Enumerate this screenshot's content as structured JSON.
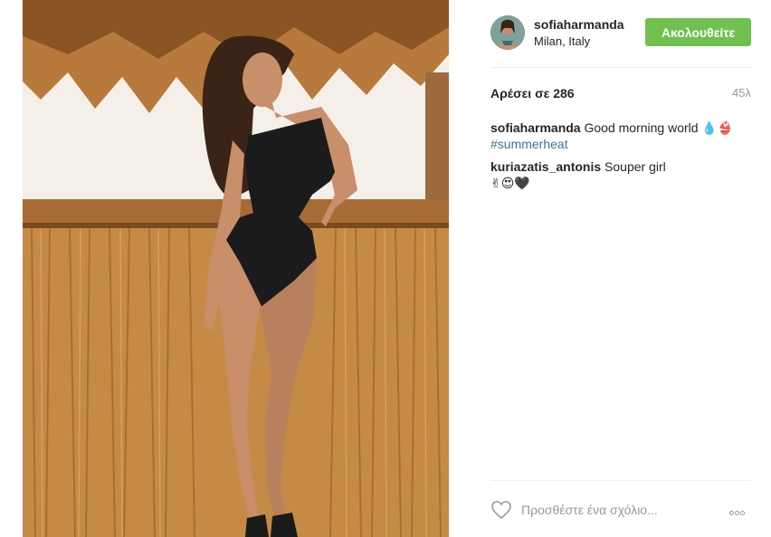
{
  "post": {
    "username": "sofiaharmanda",
    "location": "Milan, Italy",
    "follow_label": "Ακολουθείτε",
    "likes_text": "Αρέσει σε 286",
    "time_ago": "45λ",
    "caption": {
      "user": "sofiaharmanda",
      "text": "Good morning world 💧👙",
      "hashtag": "#summerheat"
    },
    "comments": [
      {
        "user": "kuriazatis_antonis",
        "text": "Souper girl",
        "emoji": "✌😍🖤"
      }
    ],
    "comment_placeholder": "Προσθέστε ένα σχόλιο..."
  },
  "icons": {
    "like": "heart-icon",
    "options": "more-options-icon"
  },
  "colors": {
    "follow_button": "#70c050",
    "hashtag": "#3f729b",
    "muted": "#999999"
  }
}
